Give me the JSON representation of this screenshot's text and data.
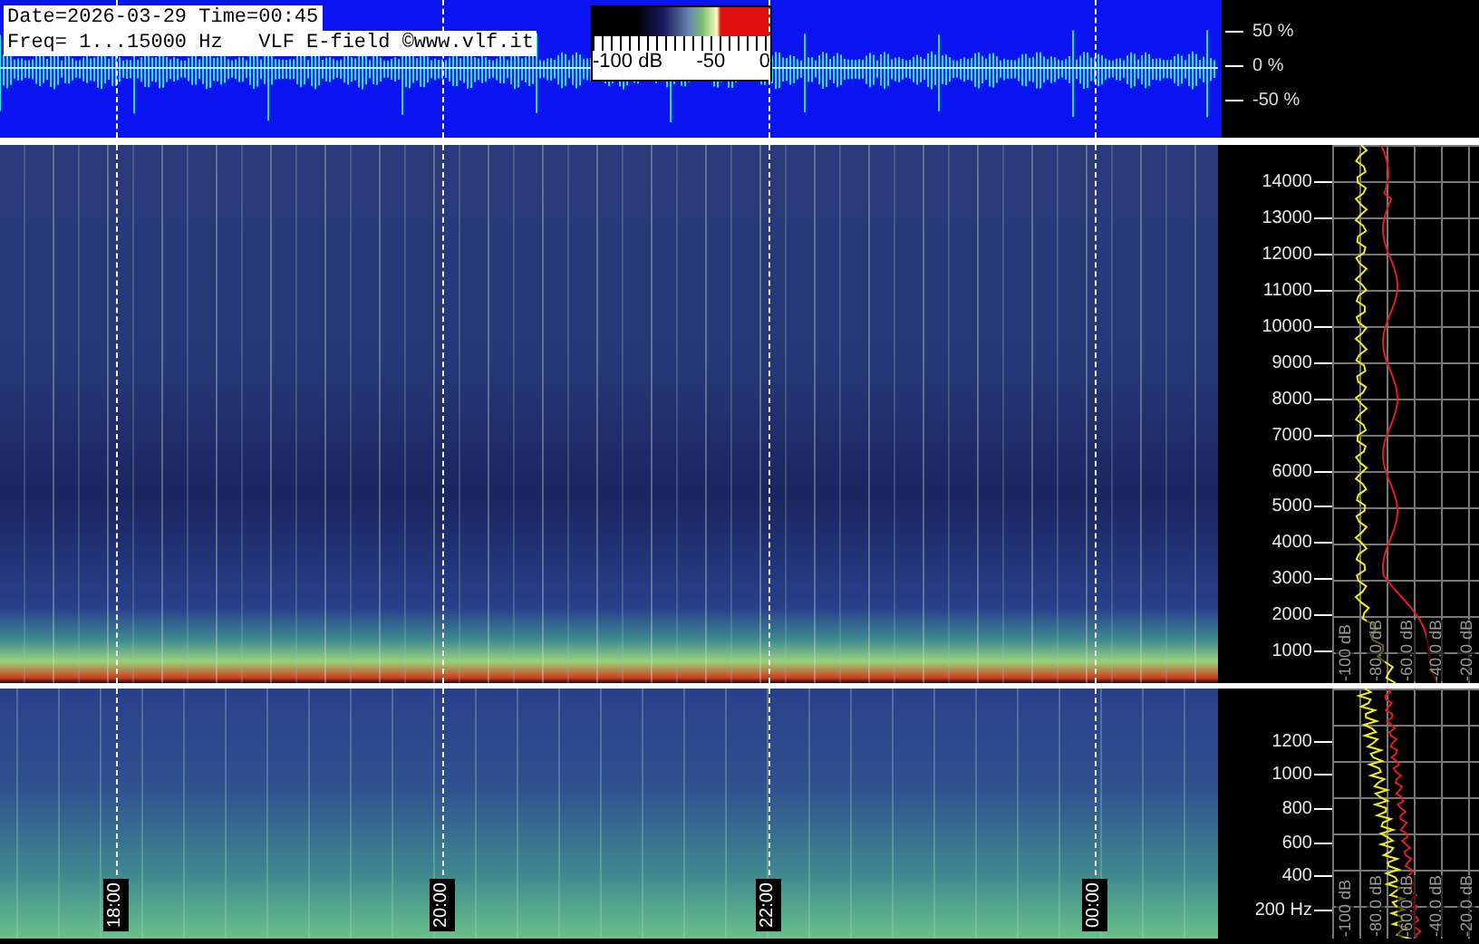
{
  "header": {
    "date_line": "Date=2026-03-29 Time=00:45",
    "freq_line": "Freq= 1...15000 Hz   VLF E-field ©www.vlf.it"
  },
  "color_scale": {
    "labels": [
      "-100 dB",
      "-50",
      "0"
    ]
  },
  "waveform_axis": [
    "50 %",
    "0 %",
    "-50 %"
  ],
  "freq_axis": [
    "14000",
    "13000",
    "12000",
    "11000",
    "10000",
    "9000",
    "8000",
    "7000",
    "6000",
    "5000",
    "4000",
    "3000",
    "2000",
    "1000"
  ],
  "db_axis": [
    "-100 dB",
    "-80.0 dB",
    "-60.0 dB",
    "-40.0 dB",
    "-20.0 dB"
  ],
  "low_freq_axis": [
    "1200",
    "1000",
    "800",
    "600",
    "400",
    "200 Hz"
  ],
  "low_db_axis": [
    "-100 dB",
    "-80.0 dB",
    "-60.0 dB",
    "-40.0 dB",
    "-20.0 dB"
  ],
  "time_markers": [
    "18:00",
    "20:00",
    "22:00",
    "00:00"
  ]
}
